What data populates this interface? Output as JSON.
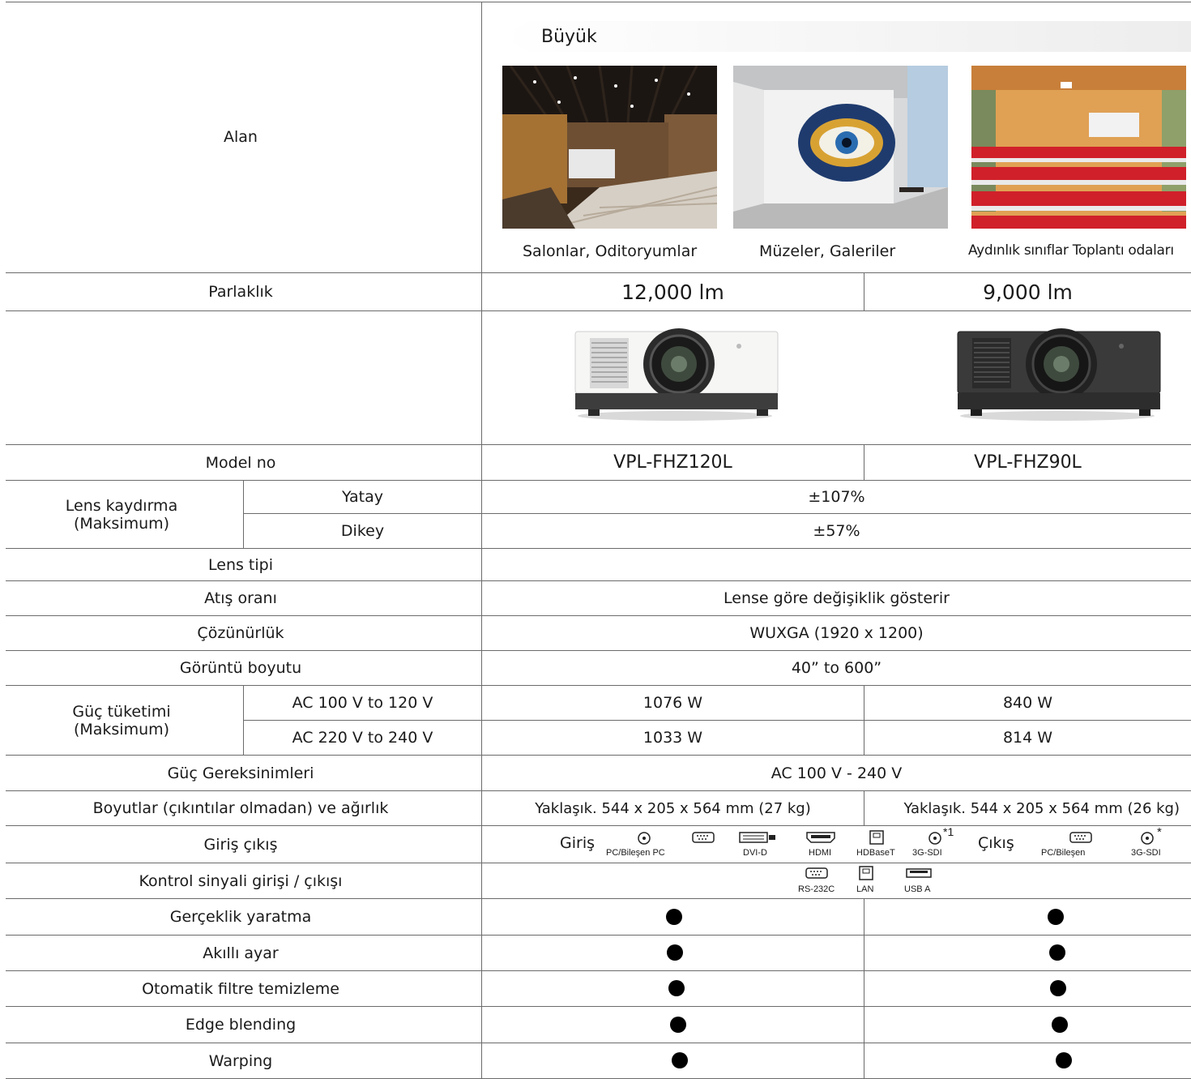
{
  "header": {
    "area_label": "Alan",
    "size_banner": "Büyük",
    "venues": [
      {
        "caption": "Salonlar, Oditoryumlar",
        "image": "auditorium-photo"
      },
      {
        "caption": "Müzeler, Galeriler",
        "image": "museum-photo"
      },
      {
        "caption": "Aydınlık sınıflar Toplantı odaları",
        "image": "classroom-photo"
      }
    ]
  },
  "models": [
    {
      "brightness": "12,000 lm",
      "model_no": "VPL-FHZ120L",
      "color": "white",
      "power_100_120": "1076 W",
      "power_220_240": "1033 W",
      "dimensions": "Yaklaşık. 544 x 205 x 564 mm (27 kg)"
    },
    {
      "brightness": "9,000 lm",
      "model_no": "VPL-FHZ90L",
      "color": "black",
      "power_100_120": "840 W",
      "power_220_240": "814 W",
      "dimensions": "Yaklaşık. 544 x 205 x 564 mm (26 kg)"
    }
  ],
  "rows": {
    "brightness": "Parlaklık",
    "model_no": "Model no",
    "lens_shift": "Lens kaydırma (Maksimum)",
    "horizontal": "Yatay",
    "horizontal_value": "±107%",
    "vertical": "Dikey",
    "vertical_value": "±57%",
    "lens_type": "Lens tipi",
    "throw_ratio": "Atış oranı",
    "throw_ratio_value": "Lense göre değişiklik gösterir",
    "resolution": "Çözünürlük",
    "resolution_value": "WUXGA (1920 x 1200)",
    "image_size": "Görüntü boyutu",
    "image_size_value": "40” to 600”",
    "power": "Güç tüketimi (Maksimum)",
    "ac_low": "AC 100 V to 120 V",
    "ac_high": "AC 220 V to 240 V",
    "power_req": "Güç Gereksinimleri",
    "power_req_value": "AC 100 V - 240 V",
    "dimensions": "Boyutlar (çıkıntılar olmadan) ve ağırlık",
    "io": "Giriş çıkış",
    "control": "Kontrol sinyali girişi / çıkışı",
    "reality_creation": "Gerçeklik yaratma",
    "smart_setting": "Akıllı ayar",
    "auto_filter": "Otomatik filtre temizleme",
    "edge_blending": "Edge blending",
    "warping": "Warping"
  },
  "io": {
    "input_label": "Giriş",
    "output_label": "Çıkış",
    "inputs": [
      "PC/Bileşen PC",
      "",
      "DVI-D",
      "HDMI",
      "HDBaseT",
      "3G-SDI"
    ],
    "sdi_note": "*1",
    "outputs": [
      "PC/Bileşen",
      "3G-SDI"
    ],
    "out_sdi_note": "*",
    "control": [
      "RS-232C",
      "LAN",
      "USB A"
    ]
  },
  "features": {
    "reality_creation": [
      true,
      true
    ],
    "smart_setting": [
      true,
      true
    ],
    "auto_filter": [
      true,
      true
    ],
    "edge_blending": [
      true,
      true
    ],
    "warping": [
      true,
      true
    ]
  }
}
